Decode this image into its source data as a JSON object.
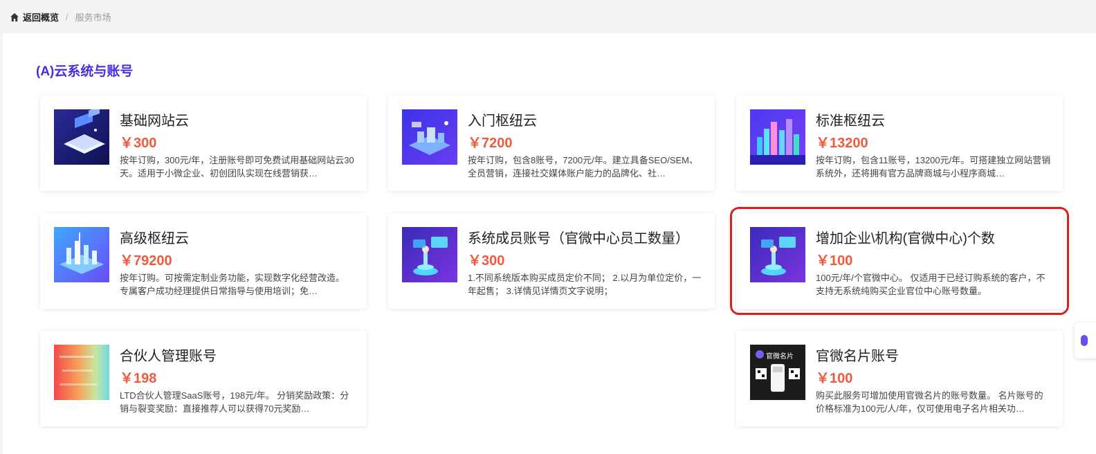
{
  "breadcrumb": {
    "back_label": "返回概览",
    "separator": "/",
    "current": "服务市场"
  },
  "section": {
    "title": "(A)云系统与账号"
  },
  "cards": [
    {
      "title": "基础网站云",
      "price": "￥300",
      "desc": "按年订购，300元/年，注册账号即可免费试用基础网站云30天。适用于小微企业、初创团队实现在线营销获…",
      "icon": "isometric-website-cloud-image"
    },
    {
      "title": "入门枢纽云",
      "price": "￥7200",
      "desc": "按年订购，包含8账号，7200元/年。建立具备SEO/SEM、全员营销，连接社交媒体账户能力的品牌化、社…",
      "icon": "isometric-hub-cloud-image"
    },
    {
      "title": "标准枢纽云",
      "price": "￥13200",
      "desc": "按年订购，包含11账号，13200元/年。可搭建独立网站营销系统外，还将拥有官方品牌商城与小程序商城…",
      "icon": "isometric-city-image"
    },
    {
      "title": "高级枢纽云",
      "price": "￥79200",
      "desc": "按年订购。可按需定制业务功能，实现数字化经营改造。 专属客户成功经理提供日常指导与使用培训；免…",
      "icon": "isometric-data-city-image"
    },
    {
      "title": "系统成员账号（官微中心员工数量）",
      "price": "￥300",
      "desc": "1.不同系统版本购买成员定价不同； 2.以月为单位定价，一年起售； 3.详情见详情页文字说明；",
      "icon": "member-account-image"
    },
    {
      "title": "增加企业\\机构(官微中心)个数",
      "price": "￥100",
      "desc": "100元/年/个官微中心。 仅适用于已经订购系统的客户，不支持无系统纯购买企业官位中心账号数量。",
      "icon": "enterprise-account-image"
    },
    {
      "title": "合伙人管理账号",
      "price": "￥198",
      "desc": "LTD合伙人管理SaaS账号，198元/年。 分销奖励政策：分销与裂变奖励：直接推荐人可以获得70元奖励…",
      "icon": "partner-gradient-image"
    },
    {
      "title": "官微名片账号",
      "price": "￥100",
      "desc": "购买此服务可增加使用官微名片的账号数量。 名片账号的价格标准为100元/人/年，仅可使用电子名片相关功…",
      "icon": "business-card-image",
      "thumb_text": "官微名片"
    }
  ],
  "colors": {
    "accent_title": "#4a2ce0",
    "price": "#ef5a3c",
    "selection_outline": "#e21a1a"
  }
}
